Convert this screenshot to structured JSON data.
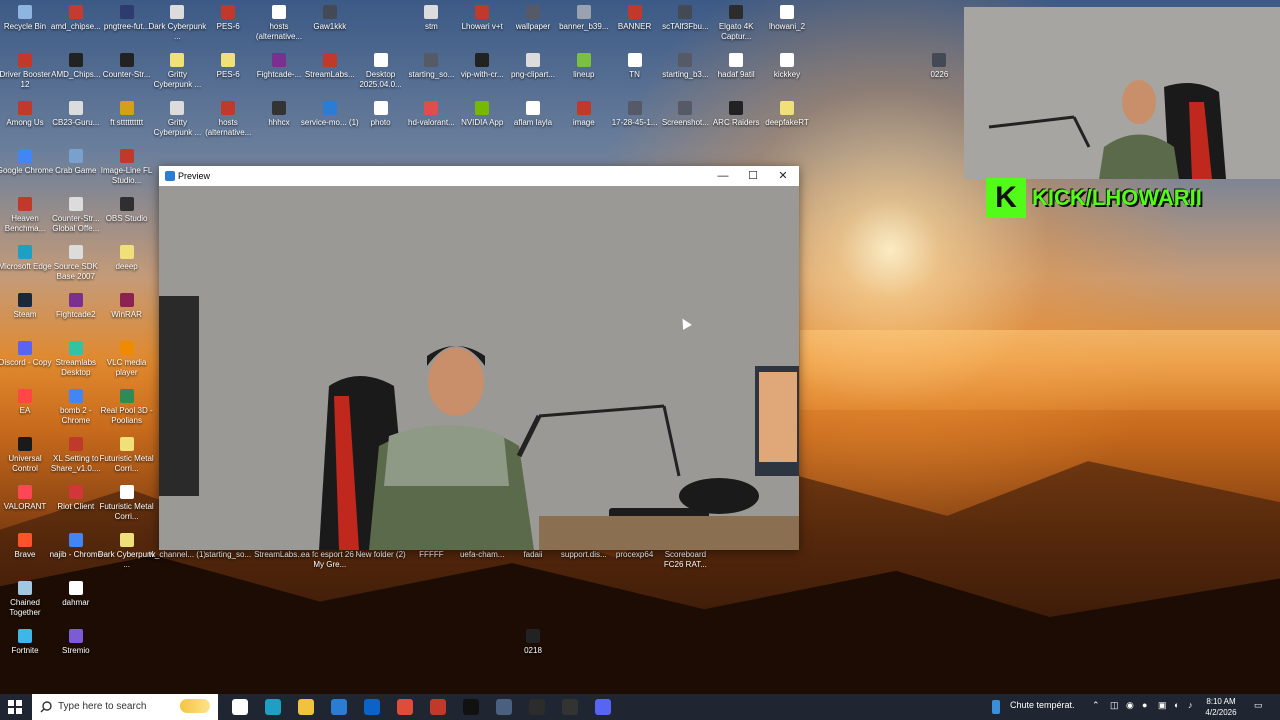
{
  "desktop": {
    "icons": [
      {
        "label": "Recycle Bin",
        "col": 0,
        "row": 0,
        "color": "#8fb4e0"
      },
      {
        "label": "amd_chipse...",
        "col": 1,
        "row": 0,
        "color": "#c63b2f"
      },
      {
        "label": "pngtree-fut...",
        "col": 2,
        "row": 0,
        "color": "#2d3b6e"
      },
      {
        "label": "Dark Cyberpunk ...",
        "col": 3,
        "row": 0,
        "color": "#dcdcdc"
      },
      {
        "label": "PES-6",
        "col": 4,
        "row": 0,
        "color": "#c0392b"
      },
      {
        "label": "hosts (alternative...",
        "col": 5,
        "row": 0,
        "color": "#ffffff"
      },
      {
        "label": "Gaw1kkk",
        "col": 6,
        "row": 0,
        "color": "#444a55"
      },
      {
        "label": "stm",
        "col": 8,
        "row": 0,
        "color": "#dcdcdc"
      },
      {
        "label": "Lhowari v+t",
        "col": 9,
        "row": 0,
        "color": "#c0392b"
      },
      {
        "label": "wallpaper",
        "col": 10,
        "row": 0,
        "color": "#555a66"
      },
      {
        "label": "banner_b39...",
        "col": 11,
        "row": 0,
        "color": "#9aa2b0"
      },
      {
        "label": "BANNER",
        "col": 12,
        "row": 0,
        "color": "#c0392b"
      },
      {
        "label": "scTAlf3Fbu...",
        "col": 13,
        "row": 0,
        "color": "#444a55"
      },
      {
        "label": "Elgato 4K Captur...",
        "col": 14,
        "row": 0,
        "color": "#2c2c2c"
      },
      {
        "label": "lhowani_2",
        "col": 15,
        "row": 0,
        "color": "#ffffff"
      },
      {
        "label": "Driver Booster 12",
        "col": 0,
        "row": 1,
        "color": "#c0392b"
      },
      {
        "label": "AMD_Chips...",
        "col": 1,
        "row": 1,
        "color": "#222222"
      },
      {
        "label": "Counter-Str...",
        "col": 2,
        "row": 1,
        "color": "#222222"
      },
      {
        "label": "Gritty Cyberpunk ...",
        "col": 3,
        "row": 1,
        "color": "#f0e07a"
      },
      {
        "label": "PES-6",
        "col": 4,
        "row": 1,
        "color": "#f0e07a"
      },
      {
        "label": "Fightcade-...",
        "col": 5,
        "row": 1,
        "color": "#7b2f8f"
      },
      {
        "label": "StreamLabs...",
        "col": 6,
        "row": 1,
        "color": "#c0392b"
      },
      {
        "label": "Desktop 2025.04.0...",
        "col": 7,
        "row": 1,
        "color": "#ffffff"
      },
      {
        "label": "starting_so...",
        "col": 8,
        "row": 1,
        "color": "#555a66"
      },
      {
        "label": "vip-with-cr...",
        "col": 9,
        "row": 1,
        "color": "#222222"
      },
      {
        "label": "png-clipart...",
        "col": 10,
        "row": 1,
        "color": "#dcdcdc"
      },
      {
        "label": "lineup",
        "col": 11,
        "row": 1,
        "color": "#7bc043"
      },
      {
        "label": "TN",
        "col": 12,
        "row": 1,
        "color": "#ffffff"
      },
      {
        "label": "starting_b3...",
        "col": 13,
        "row": 1,
        "color": "#555a66"
      },
      {
        "label": "hadaf 9atil",
        "col": 14,
        "row": 1,
        "color": "#ffffff"
      },
      {
        "label": "kickkey",
        "col": 15,
        "row": 1,
        "color": "#ffffff"
      },
      {
        "label": "Among Us",
        "col": 0,
        "row": 2,
        "color": "#c0392b"
      },
      {
        "label": "CB23-Guru...",
        "col": 1,
        "row": 2,
        "color": "#dcdcdc"
      },
      {
        "label": "ft stttttttttt",
        "col": 2,
        "row": 2,
        "color": "#d4a017"
      },
      {
        "label": "Gritty Cyberpunk ...",
        "col": 3,
        "row": 2,
        "color": "#dcdcdc"
      },
      {
        "label": "hosts (alternative...",
        "col": 4,
        "row": 2,
        "color": "#c0392b"
      },
      {
        "label": "hhhcx",
        "col": 5,
        "row": 2,
        "color": "#333333"
      },
      {
        "label": "service-mo... (1)",
        "col": 6,
        "row": 2,
        "color": "#2b7cd3"
      },
      {
        "label": "photo",
        "col": 7,
        "row": 2,
        "color": "#ffffff"
      },
      {
        "label": "hd-valorant...",
        "col": 8,
        "row": 2,
        "color": "#e14d4d"
      },
      {
        "label": "NVIDIA App",
        "col": 9,
        "row": 2,
        "color": "#76b900"
      },
      {
        "label": "aflam layla",
        "col": 10,
        "row": 2,
        "color": "#ffffff"
      },
      {
        "label": "image",
        "col": 11,
        "row": 2,
        "color": "#c0392b"
      },
      {
        "label": "17-28-45-1...",
        "col": 12,
        "row": 2,
        "color": "#555a66"
      },
      {
        "label": "Screenshot...",
        "col": 13,
        "row": 2,
        "color": "#555a66"
      },
      {
        "label": "ARC Raiders",
        "col": 14,
        "row": 2,
        "color": "#222222"
      },
      {
        "label": "deepfakeRT",
        "col": 15,
        "row": 2,
        "color": "#f0e07a"
      },
      {
        "label": "Google Chrome",
        "col": 0,
        "row": 3,
        "color": "#4285f4"
      },
      {
        "label": "Crab Game",
        "col": 1,
        "row": 3,
        "color": "#7aa0d0"
      },
      {
        "label": "Image-Line FL Studio...",
        "col": 2,
        "row": 3,
        "color": "#c0392b"
      },
      {
        "label": "Heaven Benchma...",
        "col": 0,
        "row": 4,
        "color": "#c0392b"
      },
      {
        "label": "Counter-Str... Global Offe...",
        "col": 1,
        "row": 4,
        "color": "#dcdcdc"
      },
      {
        "label": "OBS Studio",
        "col": 2,
        "row": 4,
        "color": "#302e31"
      },
      {
        "label": "Microsoft Edge",
        "col": 0,
        "row": 5,
        "color": "#1da0c3"
      },
      {
        "label": "Source SDK Base 2007",
        "col": 1,
        "row": 5,
        "color": "#dcdcdc"
      },
      {
        "label": "deeep",
        "col": 2,
        "row": 5,
        "color": "#f0e07a"
      },
      {
        "label": "Steam",
        "col": 0,
        "row": 6,
        "color": "#1b2838"
      },
      {
        "label": "Fightcade2",
        "col": 1,
        "row": 6,
        "color": "#7b2f8f"
      },
      {
        "label": "WinRAR",
        "col": 2,
        "row": 6,
        "color": "#8b2252"
      },
      {
        "label": "Discord - Copy",
        "col": 0,
        "row": 7,
        "color": "#5865f2"
      },
      {
        "label": "Streamlabs Desktop",
        "col": 1,
        "row": 7,
        "color": "#31c3a2"
      },
      {
        "label": "VLC media player",
        "col": 2,
        "row": 7,
        "color": "#f08a00"
      },
      {
        "label": "EA",
        "col": 0,
        "row": 8,
        "color": "#ff4747"
      },
      {
        "label": "bomb 2 - Chrome",
        "col": 1,
        "row": 8,
        "color": "#4285f4"
      },
      {
        "label": "Real Pool 3D - Poolians",
        "col": 2,
        "row": 8,
        "color": "#2e8b57"
      },
      {
        "label": "Universal Control",
        "col": 0,
        "row": 9,
        "color": "#1a1a1a"
      },
      {
        "label": "XL Setting to Share_v1.0....",
        "col": 1,
        "row": 9,
        "color": "#c0392b"
      },
      {
        "label": "Futuristic Metal Corri...",
        "col": 2,
        "row": 9,
        "color": "#f0e07a"
      },
      {
        "label": "VALORANT",
        "col": 0,
        "row": 10,
        "color": "#ff4655"
      },
      {
        "label": "Riot Client",
        "col": 1,
        "row": 10,
        "color": "#d13639"
      },
      {
        "label": "Futuristic Metal Corri...",
        "col": 2,
        "row": 10,
        "color": "#ffffff"
      },
      {
        "label": "Brave",
        "col": 0,
        "row": 11,
        "color": "#fb542b"
      },
      {
        "label": "najib - Chrome",
        "col": 1,
        "row": 11,
        "color": "#4285f4"
      },
      {
        "label": "Dark Cyberpunk ...",
        "col": 2,
        "row": 11,
        "color": "#f0e07a"
      },
      {
        "label": "Chained Together",
        "col": 0,
        "row": 12,
        "color": "#a0c8e0"
      },
      {
        "label": "dahmar",
        "col": 1,
        "row": 12,
        "color": "#ffffff"
      },
      {
        "label": "Fortnite",
        "col": 0,
        "row": 13,
        "color": "#3fb6e8"
      },
      {
        "label": "Stremio",
        "col": 1,
        "row": 13,
        "color": "#7b5bd6"
      },
      {
        "label": "tv_channel... (1)",
        "col": 3,
        "row": 11,
        "color": "#555a66"
      },
      {
        "label": "starting_so...",
        "col": 4,
        "row": 11,
        "color": "#555a66"
      },
      {
        "label": "StreamLabs...",
        "col": 5,
        "row": 11,
        "color": "#555a66"
      },
      {
        "label": "ea fc esport 26 - My Gre...",
        "col": 6,
        "row": 11,
        "color": "#555a66"
      },
      {
        "label": "New folder (2)",
        "col": 7,
        "row": 11,
        "color": "#f0e07a"
      },
      {
        "label": "FFFFF",
        "col": 8,
        "row": 11,
        "color": "#555a66"
      },
      {
        "label": "uefa-cham...",
        "col": 9,
        "row": 11,
        "color": "#555a66"
      },
      {
        "label": "fadaii",
        "col": 10,
        "row": 11,
        "color": "#555a66"
      },
      {
        "label": "support.dis...",
        "col": 11,
        "row": 11,
        "color": "#555a66"
      },
      {
        "label": "procexp64",
        "col": 12,
        "row": 11,
        "color": "#555a66"
      },
      {
        "label": "Scoreboard FC26 RAT...",
        "col": 13,
        "row": 11,
        "color": "#555a66"
      },
      {
        "label": "0218",
        "col": 10,
        "row": 13,
        "color": "#222222"
      },
      {
        "label": "0226",
        "col": 18,
        "row": 1,
        "color": "#444a55"
      }
    ]
  },
  "preview_window": {
    "title": "Preview",
    "minimize": "—",
    "maximize": "☐",
    "close": "✕"
  },
  "stream_overlay": {
    "kick_logo": "K",
    "kick_handle": "KICK/LHOWARII"
  },
  "taskbar": {
    "search_placeholder": "Type here to search",
    "weather_text": "Chute températ.",
    "time": "8:10 AM",
    "date": "4/2/2026",
    "pinned": [
      {
        "name": "task-view-icon",
        "color": "#ffffff"
      },
      {
        "name": "edge-icon",
        "color": "#1da0c3"
      },
      {
        "name": "file-explorer-icon",
        "color": "#f0c23e"
      },
      {
        "name": "store-icon",
        "color": "#2b7cd3"
      },
      {
        "name": "outlook-icon",
        "color": "#0a64c8"
      },
      {
        "name": "chrome-icon",
        "color": "#e04b3a"
      },
      {
        "name": "obs-icon",
        "color": "#c0392b"
      },
      {
        "name": "terminal-icon",
        "color": "#111111"
      },
      {
        "name": "preview-app-icon",
        "color": "#4a6080"
      },
      {
        "name": "elgato-4k-icon",
        "color": "#2c2c2c"
      },
      {
        "name": "steam-icon",
        "color": "#333333"
      },
      {
        "name": "discord-icon",
        "color": "#5865f2"
      }
    ]
  }
}
